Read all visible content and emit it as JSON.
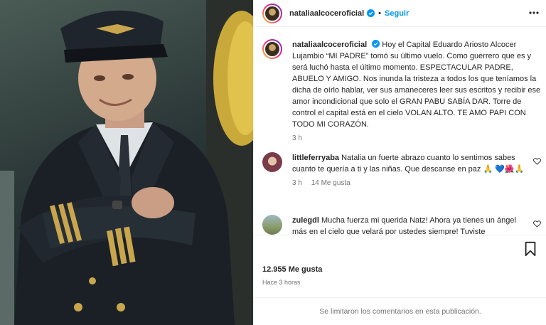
{
  "post": {
    "username": "nataliaalcoceroficial",
    "follow_label": "Seguir",
    "caption_text": "Hoy el Capital Eduardo Ariosto Alcocer Lujambio “MI PADRE” tomó su último vuelo. Como guerrero que es y será luchó hasta el último momento. ESPECTACULAR PADRE, ABUELO Y AMIGO. Nos inunda la tristeza a todos los que teníamos la dicha de oírlo hablar, ver sus amaneceres leer sus escritos y recibir ese amor incondicional que solo el GRAN PABU SABÍA DAR. Torre de control el capital está en el cielo VOLAN ALTO. TE AMO PAPI CON TODO MI CORAZÓN.",
    "caption_age": "3 h"
  },
  "comments": [
    {
      "username": "littleferryaba",
      "text": "Natalia un fuerte abrazo cuanto lo sentimos sabes cuanto te quería a ti y las niñas. Que descanse en paz 🙏 💙🌺🙏",
      "age": "3 h",
      "likes": "14 Me gusta"
    },
    {
      "username": "zulegdl",
      "text": "Mucha fuerza mi querida Natz! Ahora ya tienes un ángel más en el cielo que velará por ustedes siempre! Tuviste"
    }
  ],
  "actions": {
    "likes": "12.955 Me gusta",
    "posted": "Hace 3 horas",
    "comments_disabled": "Se limitaron los comentarios en esta publicación."
  },
  "icons": {
    "more": "more-options-icon",
    "like": "heart-icon",
    "comment": "comment-icon",
    "share": "share-icon",
    "save": "bookmark-icon",
    "verified": "verified-badge-icon"
  },
  "colors": {
    "accent": "#0095f6",
    "muted": "#737373",
    "text": "#262626"
  }
}
